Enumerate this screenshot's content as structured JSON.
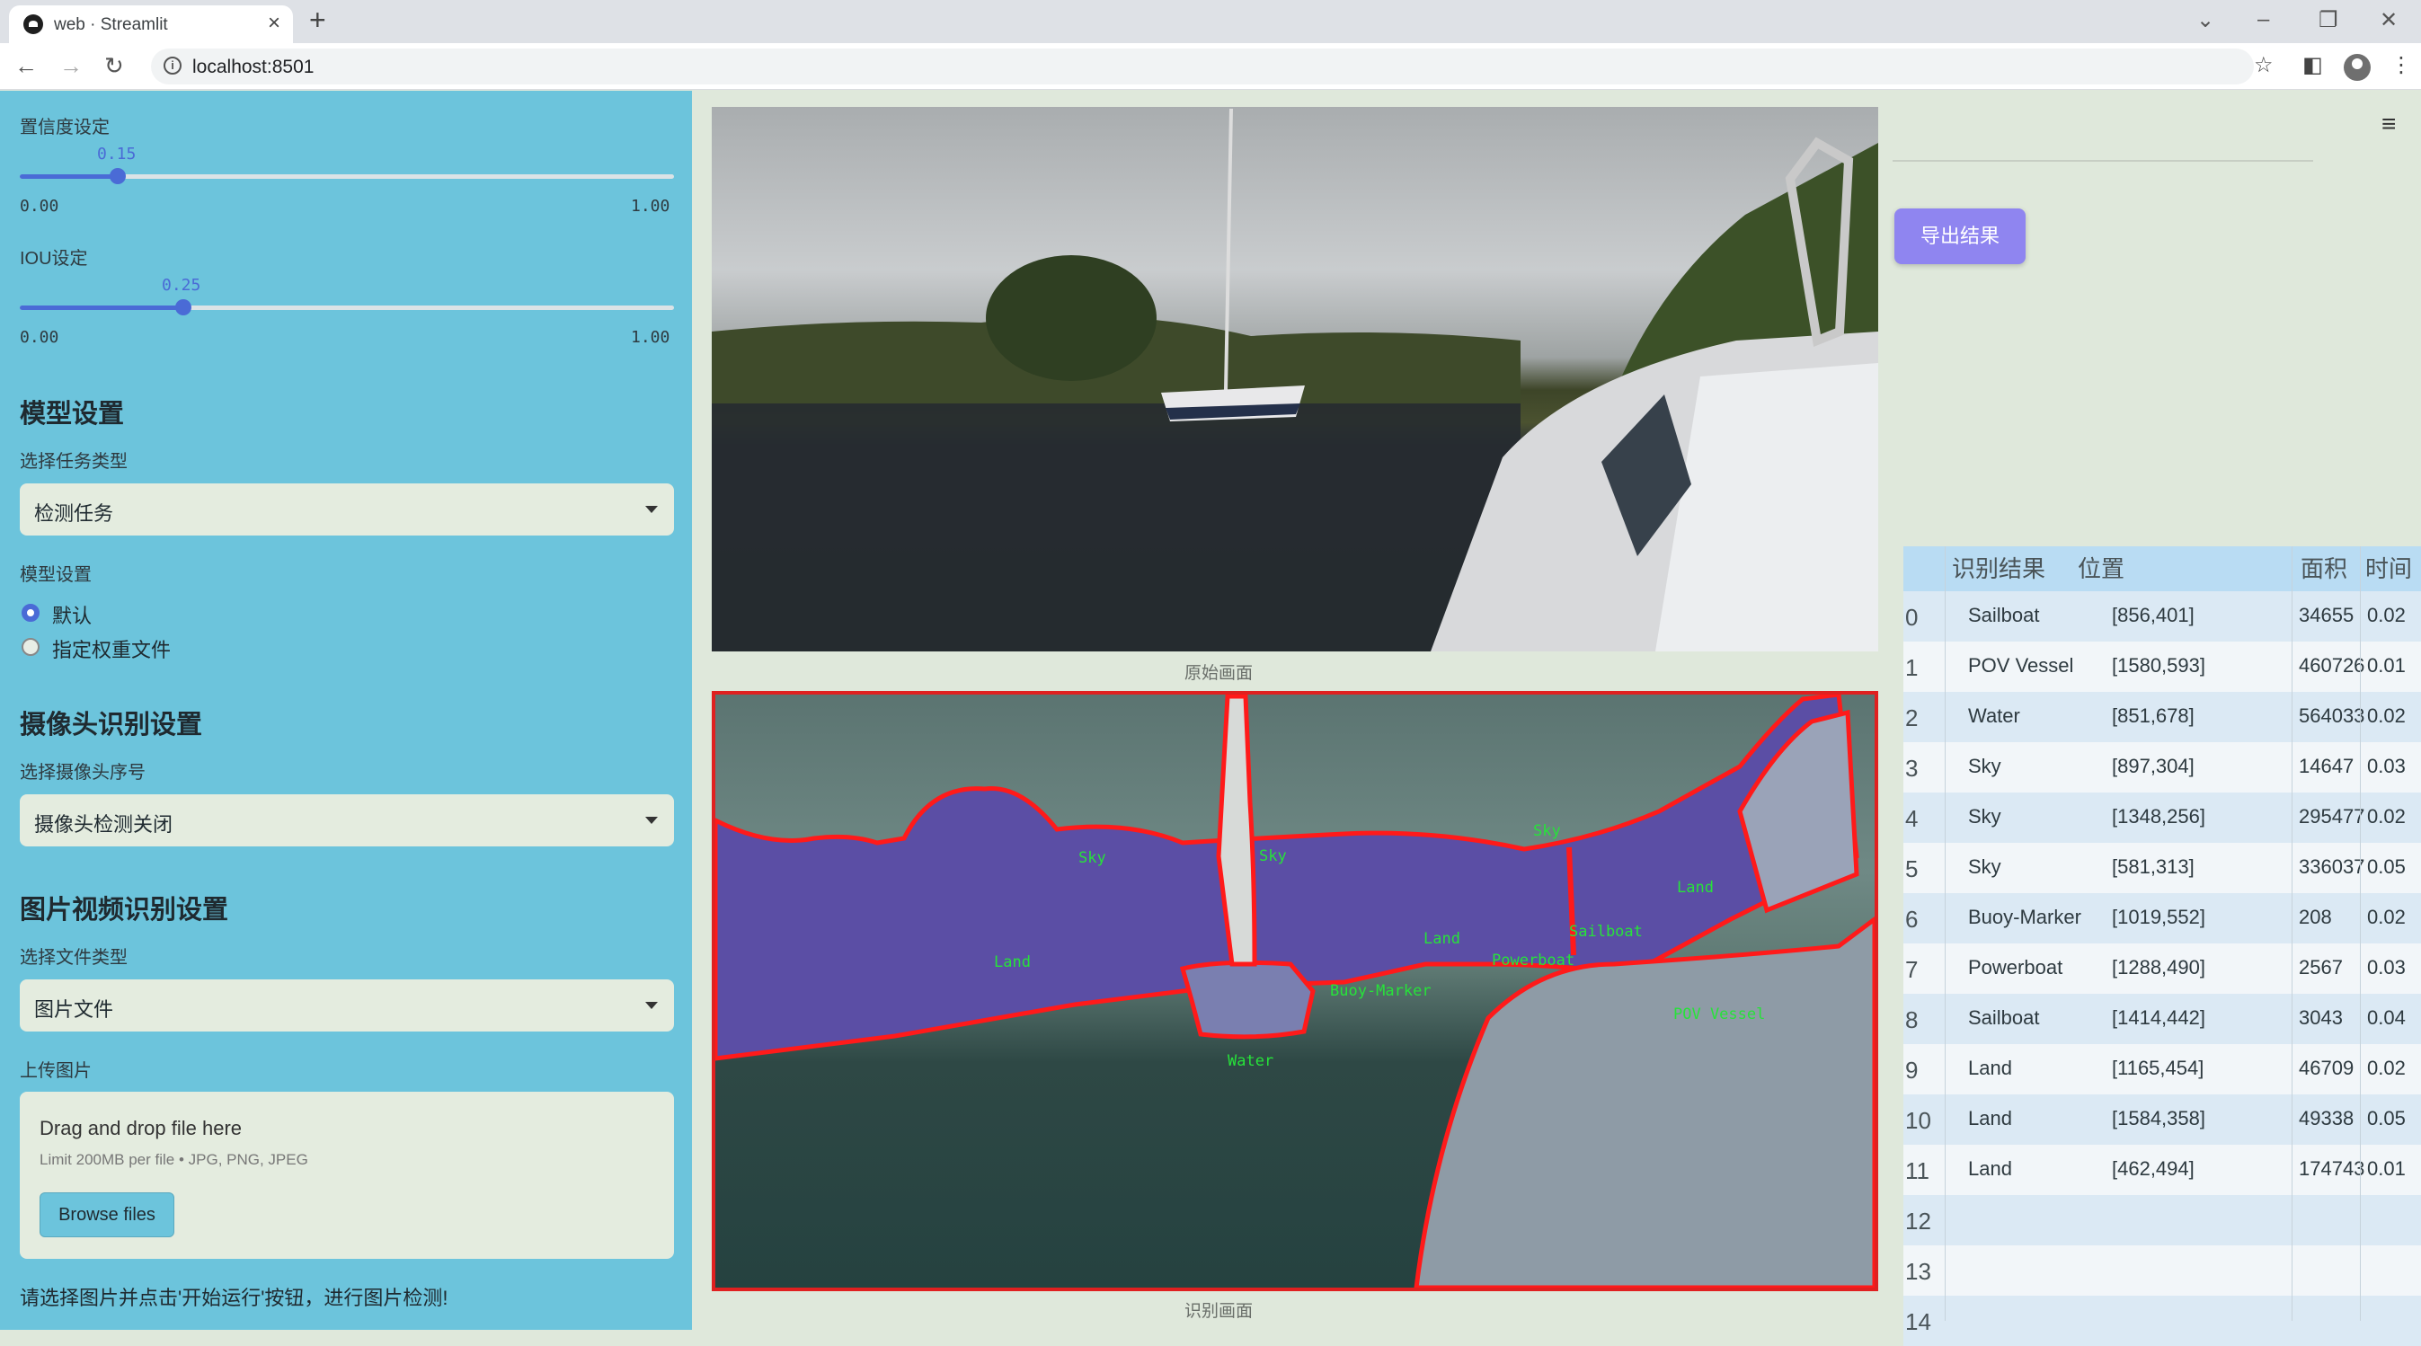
{
  "browser": {
    "tab_title": "web · Streamlit",
    "url": "localhost:8501"
  },
  "sidebar": {
    "confidence": {
      "label": "置信度设定",
      "value": "0.15",
      "min": "0.00",
      "max": "1.00",
      "level": 0.15
    },
    "iou": {
      "label": "IOU设定",
      "value": "0.25",
      "min": "0.00",
      "max": "1.00",
      "level": 0.25
    },
    "model_heading": "模型设置",
    "task_label": "选择任务类型",
    "task_value": "检测任务",
    "model_label": "模型设置",
    "model_options": [
      "默认",
      "指定权重文件"
    ],
    "camera_heading": "摄像头识别设置",
    "camera_label": "选择摄像头序号",
    "camera_value": "摄像头检测关闭",
    "media_heading": "图片视频识别设置",
    "file_type_label": "选择文件类型",
    "file_type_value": "图片文件",
    "upload_label": "上传图片",
    "drop_title": "Drag and drop file here",
    "drop_limit": "Limit 200MB per file • JPG, PNG, JPEG",
    "browse_label": "Browse files",
    "hint": "请选择图片并点击'开始运行'按钮，进行图片检测!"
  },
  "main": {
    "original_caption": "原始画面",
    "detected_caption": "识别画面",
    "seg_labels": [
      "Sky",
      "Sky",
      "Sky",
      "Land",
      "Land",
      "Land",
      "Sailboat",
      "Powerboat",
      "Buoy-Marker",
      "Water",
      "POV Vessel"
    ]
  },
  "right": {
    "export_label": "导出结果",
    "table": {
      "headers": [
        "识别结果",
        "位置",
        "面积",
        "时间"
      ],
      "rows": [
        [
          "Sailboat",
          "[856,401]",
          "34655",
          "0.02"
        ],
        [
          "POV Vessel",
          "[1580,593]",
          "460726",
          "0.01"
        ],
        [
          "Water",
          "[851,678]",
          "564033",
          "0.02"
        ],
        [
          "Sky",
          "[897,304]",
          "14647",
          "0.03"
        ],
        [
          "Sky",
          "[1348,256]",
          "295477",
          "0.02"
        ],
        [
          "Sky",
          "[581,313]",
          "336037",
          "0.05"
        ],
        [
          "Buoy-Marker",
          "[1019,552]",
          "208",
          "0.02"
        ],
        [
          "Powerboat",
          "[1288,490]",
          "2567",
          "0.03"
        ],
        [
          "Sailboat",
          "[1414,442]",
          "3043",
          "0.04"
        ],
        [
          "Land",
          "[1165,454]",
          "46709",
          "0.02"
        ],
        [
          "Land",
          "[1584,358]",
          "49338",
          "0.05"
        ],
        [
          "Land",
          "[462,494]",
          "174743",
          "0.01"
        ]
      ],
      "index_labels": [
        "0",
        "1",
        "2",
        "3",
        "4",
        "5",
        "6",
        "7",
        "8",
        "9",
        "10",
        "11",
        "12",
        "13",
        "14"
      ]
    }
  },
  "colors": {
    "sidebar": "#6cc4dc",
    "accent": "#4a6bd6",
    "export": "#8f85f0",
    "detection_outline": "#e02020",
    "label_green": "#27e23a"
  }
}
